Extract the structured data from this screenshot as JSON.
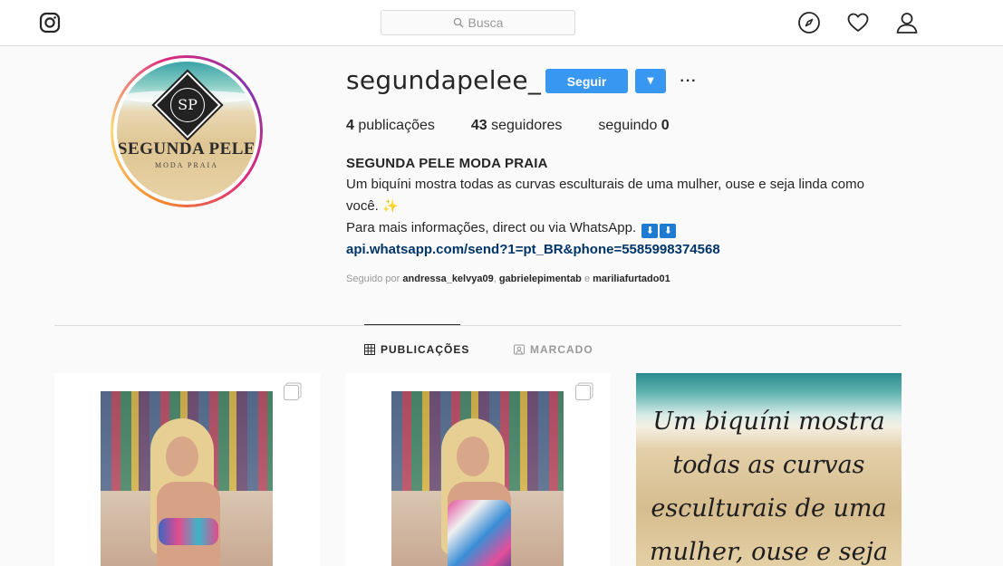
{
  "header": {
    "search_placeholder": "Busca"
  },
  "profile": {
    "username": "segundapelee_",
    "follow_label": "Seguir",
    "dropdown_glyph": "▼",
    "more_glyph": "···",
    "avatar": {
      "monogram": "SP",
      "brand": "SEGUNDA PELE",
      "tagline": "MODA PRAIA"
    },
    "stats": {
      "posts_count": "4",
      "posts_label": "publicações",
      "followers_count": "43",
      "followers_label": "seguidores",
      "following_label": "seguindo",
      "following_count": "0"
    },
    "bio": {
      "name": "SEGUNDA PELE MODA PRAIA",
      "line1": "Um biquíni mostra todas as curvas esculturais de uma mulher, ouse e seja linda como",
      "line2": "você. ",
      "line2_emoji": "✨",
      "line3": "Para mais informações, direct ou via WhatsApp. ",
      "arrow_emoji": "⬇",
      "link": "api.whatsapp.com/send?1=pt_BR&phone=5585998374568"
    },
    "followed_by": {
      "prefix": "Seguido por ",
      "user1": "andressa_kelvya09",
      "sep1": ", ",
      "user2": "gabrielepimentab",
      "sep2": " e ",
      "user3": "mariliafurtado01"
    }
  },
  "tabs": {
    "posts_label": "PUBLICAÇÕES",
    "tagged_label": "MARCADO",
    "active": "posts"
  },
  "posts": {
    "quote_text": "Um biquíni mostra todas as curvas esculturais de uma mulher, ouse e seja"
  },
  "colors": {
    "accent": "#3897f0",
    "link": "#003569",
    "border": "#dbdbdb",
    "muted": "#999999"
  }
}
